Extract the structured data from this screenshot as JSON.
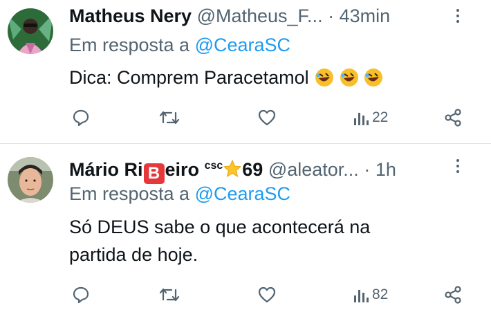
{
  "tweets": [
    {
      "name": "Matheus Nery",
      "handle": "@Matheus_F...",
      "dot": "·",
      "time": "43min",
      "reply_prefix": "Em resposta a",
      "reply_mention": "@CearaSC",
      "text": "Dica: Comprem Paracetamol",
      "emoji": [
        "rolling-on-floor-laughing",
        "rolling-on-floor-laughing",
        "rolling-on-floor-laughing"
      ],
      "views": "22"
    },
    {
      "name_part1": "Mário Ri",
      "name_badge": "B",
      "name_part2": "eiro",
      "name_super": "csc",
      "name_part3": "69",
      "handle": "@aleator...",
      "dot": "·",
      "time": "1h",
      "reply_prefix": "Em resposta a",
      "reply_mention": "@CearaSC",
      "text_line1": "Só DEUS sabe o que acontecerá na",
      "text_line2": "partida de hoje.",
      "views": "82"
    }
  ],
  "colors": {
    "text": "#0f1419",
    "muted": "#536471",
    "link": "#1d9bf0",
    "divider": "#dde2e6"
  },
  "icons": [
    "reply-icon",
    "retweet-icon",
    "like-icon",
    "views-icon",
    "share-icon",
    "more-icon",
    "star-icon",
    "b-badge-icon"
  ]
}
